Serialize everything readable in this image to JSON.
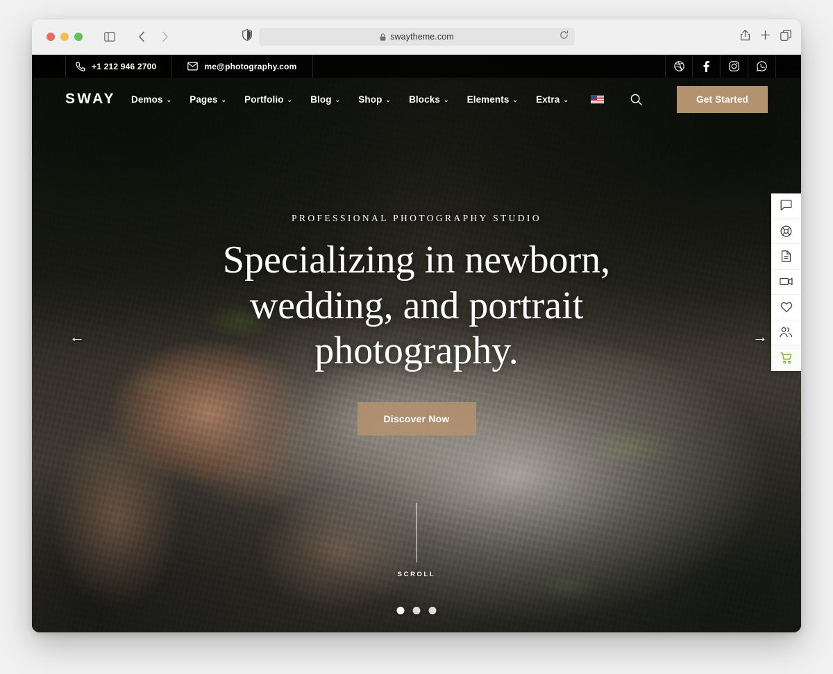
{
  "browser": {
    "url": "swaytheme.com",
    "lock_icon": "lock-icon",
    "traffic_lights": [
      "close",
      "minimize",
      "maximize"
    ],
    "sidebar_icon": "sidebar-toggle-icon",
    "back_icon": "chevron-left-icon",
    "forward_icon": "chevron-right-icon",
    "shield_icon": "privacy-shield-icon",
    "reload_icon": "reload-icon",
    "share_icon": "share-icon",
    "new_tab_icon": "plus-icon",
    "tabs_icon": "tab-overview-icon"
  },
  "topbar": {
    "phone": "+1 212 946 2700",
    "email": "me@photography.com",
    "phone_icon": "phone-icon",
    "email_icon": "mail-icon",
    "socials": [
      {
        "name": "dribbble",
        "icon": "dribbble-icon"
      },
      {
        "name": "facebook",
        "icon": "facebook-icon"
      },
      {
        "name": "instagram",
        "icon": "instagram-icon"
      },
      {
        "name": "whatsapp",
        "icon": "whatsapp-icon"
      }
    ]
  },
  "nav": {
    "brand": "SWAY",
    "items": [
      {
        "label": "Demos",
        "has_dropdown": true
      },
      {
        "label": "Pages",
        "has_dropdown": true
      },
      {
        "label": "Portfolio",
        "has_dropdown": true
      },
      {
        "label": "Blog",
        "has_dropdown": true
      },
      {
        "label": "Shop",
        "has_dropdown": true
      },
      {
        "label": "Blocks",
        "has_dropdown": true
      },
      {
        "label": "Elements",
        "has_dropdown": true
      },
      {
        "label": "Extra",
        "has_dropdown": true
      }
    ],
    "caret": "⌄",
    "language_flag": "us-flag-icon",
    "search_icon": "search-icon",
    "cta_label": "Get Started",
    "cta_color": "#b3926f"
  },
  "hero": {
    "eyebrow": "PROFESSIONAL PHOTOGRAPHY STUDIO",
    "headline": "Specializing in newborn, wedding, and portrait photography.",
    "cta_label": "Discover Now",
    "cta_color": "#b3926f",
    "prev_arrow": "←",
    "next_arrow": "→",
    "scroll_label": "SCROLL",
    "dots": 3,
    "active_dot": 0
  },
  "side_toolbar": {
    "items": [
      {
        "name": "chat",
        "icon": "chat-bubble-icon"
      },
      {
        "name": "support",
        "icon": "lifebuoy-icon"
      },
      {
        "name": "document",
        "icon": "document-icon"
      },
      {
        "name": "video",
        "icon": "video-camera-icon"
      },
      {
        "name": "wishlist",
        "icon": "heart-icon"
      },
      {
        "name": "account",
        "icon": "users-icon"
      },
      {
        "name": "cart",
        "icon": "shopping-cart-icon",
        "color": "#7fa93f"
      }
    ]
  }
}
